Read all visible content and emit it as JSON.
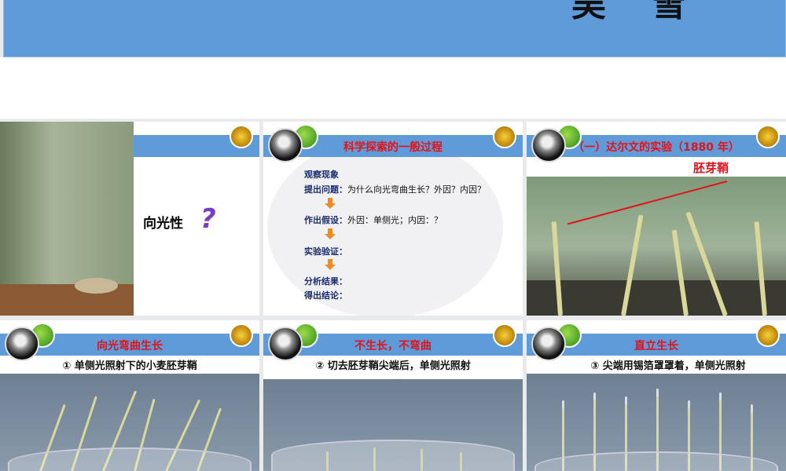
{
  "header": {
    "author": "吴雪"
  },
  "slides": [
    {
      "label": "向光性",
      "mark": "?"
    },
    {
      "title": "科学探索的一般过程",
      "steps": [
        {
          "name": "观察现象",
          "text": ""
        },
        {
          "name": "提出问题：",
          "text": "为什么向光弯曲生长？外因？内因？"
        },
        {
          "name": "作出假设：",
          "text": "外因：单侧光；内因：？"
        },
        {
          "name": "实验验证：",
          "text": ""
        },
        {
          "name": "分析结果：",
          "text": ""
        },
        {
          "name": "得出结论：",
          "text": ""
        }
      ]
    },
    {
      "title": "（一）达尔文的实验（1880 年）",
      "annotation": "胚芽鞘"
    },
    {
      "title": "向光弯曲生长",
      "caption": "① 单侧光照射下的小麦胚芽鞘"
    },
    {
      "title": "不生长，不弯曲",
      "caption": "② 切去胚芽鞘尖端后，单侧光照射"
    },
    {
      "title": "直立生长",
      "caption": "③ 尖端用锡箔罩罩着，单侧光照射"
    }
  ]
}
